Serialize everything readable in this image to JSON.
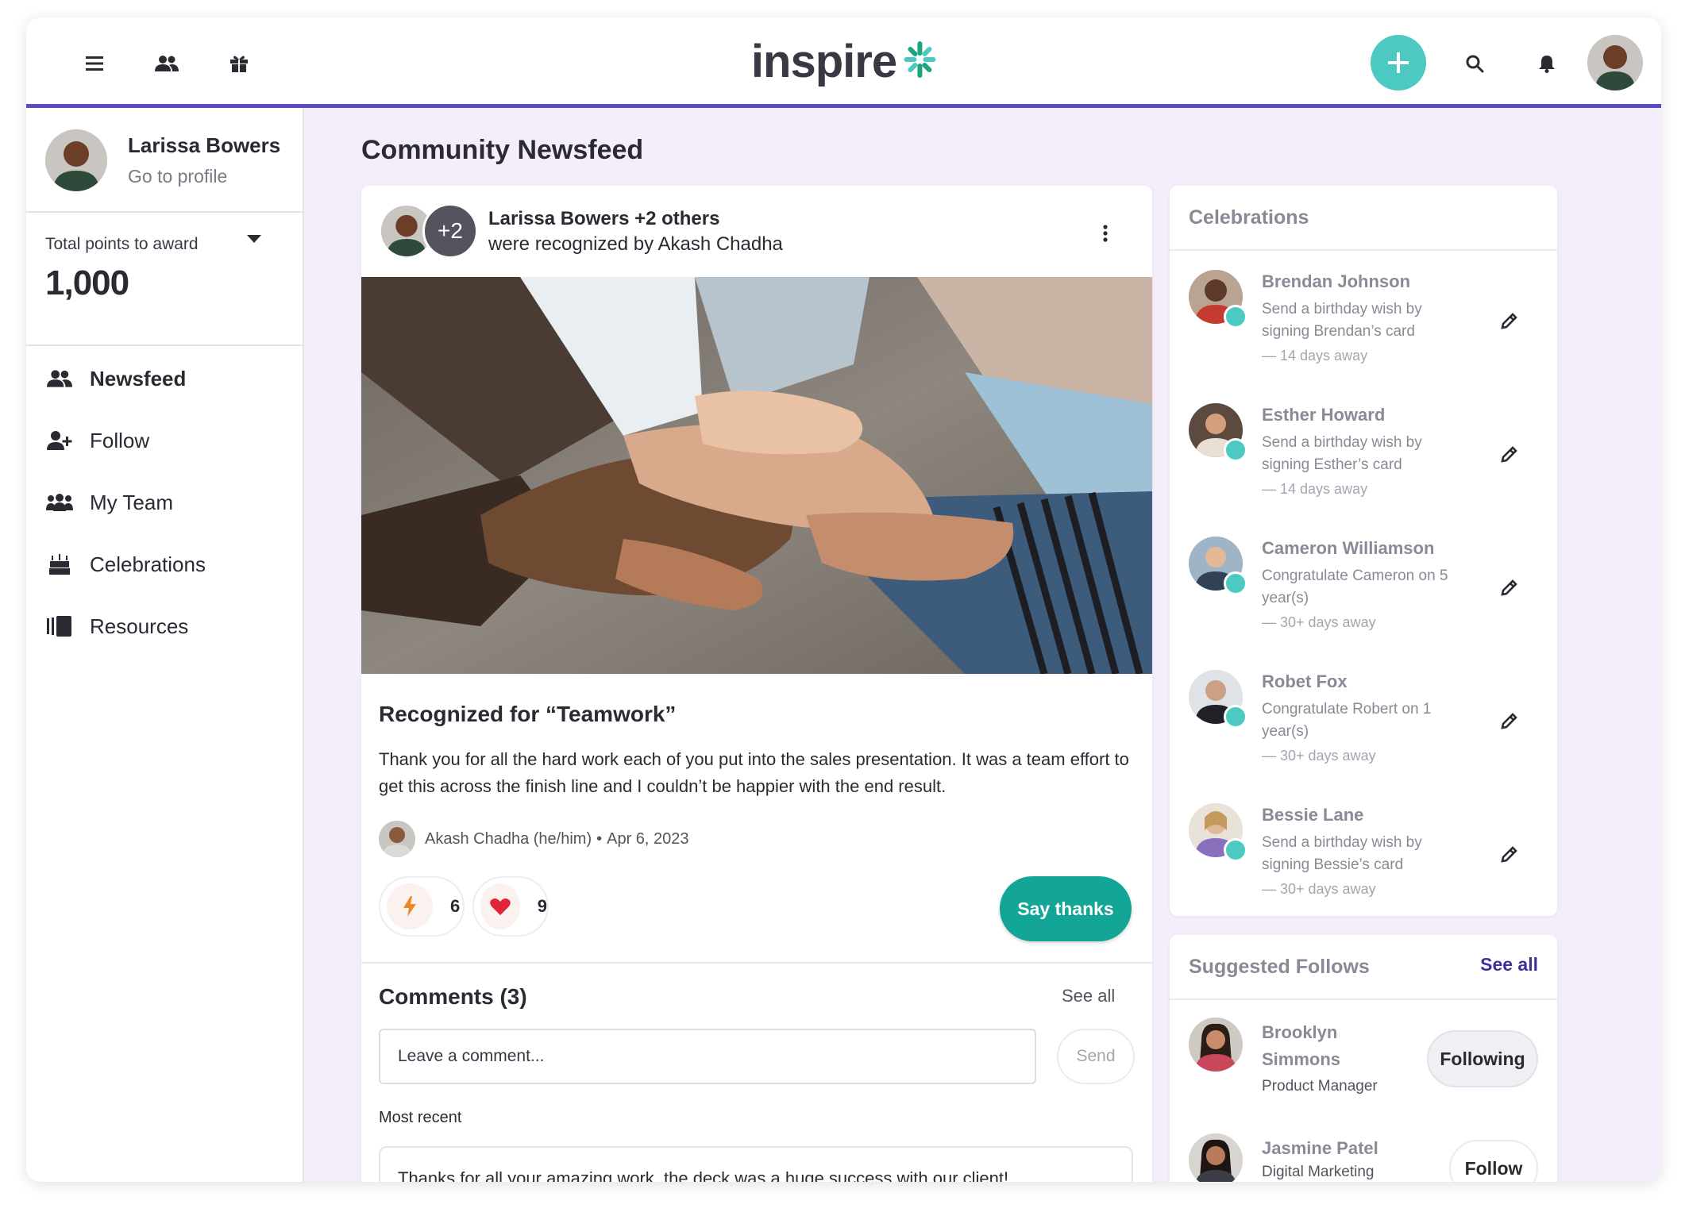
{
  "app": {
    "logo_text": "inspire",
    "brand_color": "#5a4cc7",
    "accent": "#4cc9c0"
  },
  "topbar": {
    "left_icons": [
      "menu-icon",
      "people-icon",
      "gift-icon"
    ],
    "right_icons": [
      "add-icon",
      "search-icon",
      "bell-icon",
      "avatar"
    ]
  },
  "profile": {
    "name": "Larissa Bowers",
    "link": "Go to profile"
  },
  "points": {
    "label": "Total points to award",
    "value": "1,000"
  },
  "nav": {
    "items": [
      {
        "label": "Newsfeed",
        "icon": "people-icon",
        "active": true
      },
      {
        "label": "Follow",
        "icon": "add-person-icon",
        "active": false
      },
      {
        "label": "My Team",
        "icon": "team-icon",
        "active": false
      },
      {
        "label": "Celebrations",
        "icon": "cake-icon",
        "active": false
      },
      {
        "label": "Resources",
        "icon": "resources-icon",
        "active": false
      }
    ]
  },
  "main": {
    "title": "Community Newsfeed"
  },
  "post": {
    "extra_count": "+2",
    "headline": "Larissa Bowers +2 others",
    "subline": "were recognized by Akash Chadha",
    "title": "Recognized for “Teamwork”",
    "body": "Thank you for all the hard work each of you put into the sales presentation. It was a team effort to get this across the finish line and I couldn’t be happier with the end result.",
    "author": "Akash Chadha (he/him)",
    "separator": "•",
    "date": "Apr 6, 2023",
    "reactions": [
      {
        "icon": "lightning-icon",
        "count": "6"
      },
      {
        "icon": "heart-icon",
        "count": "9"
      }
    ],
    "say_thanks": "Say thanks"
  },
  "comments": {
    "title": "Comments (3)",
    "see_all": "See all",
    "placeholder": "Leave a comment...",
    "send": "Send",
    "sort_label": "Most recent",
    "first_comment": "Thanks for all your amazing work, the deck was a huge success with our client!"
  },
  "celebrations": {
    "title": "Celebrations",
    "items": [
      {
        "name": "Brendan Johnson",
        "message": "Send a birthday wish by signing Brendan’s card",
        "when": "— 14 days away"
      },
      {
        "name": "Esther Howard",
        "message": "Send a birthday wish by signing Esther’s card",
        "when": "— 14 days away"
      },
      {
        "name": "Cameron Williamson",
        "message": "Congratulate Cameron on 5 year(s)",
        "when": "— 30+ days away"
      },
      {
        "name": "Robet Fox",
        "message": "Congratulate Robert on 1 year(s)",
        "when": "— 30+ days away"
      },
      {
        "name": "Bessie Lane",
        "message": "Send a birthday wish by signing Bessie’s card",
        "when": "— 30+ days away"
      }
    ]
  },
  "suggested": {
    "title": "Suggested Follows",
    "see_all": "See all",
    "items": [
      {
        "name": "Brooklyn Simmons",
        "role": "Product Manager",
        "button": "Following"
      },
      {
        "name": "Jasmine Patel",
        "role": "Digital Marketing",
        "button": "Follow"
      }
    ]
  }
}
